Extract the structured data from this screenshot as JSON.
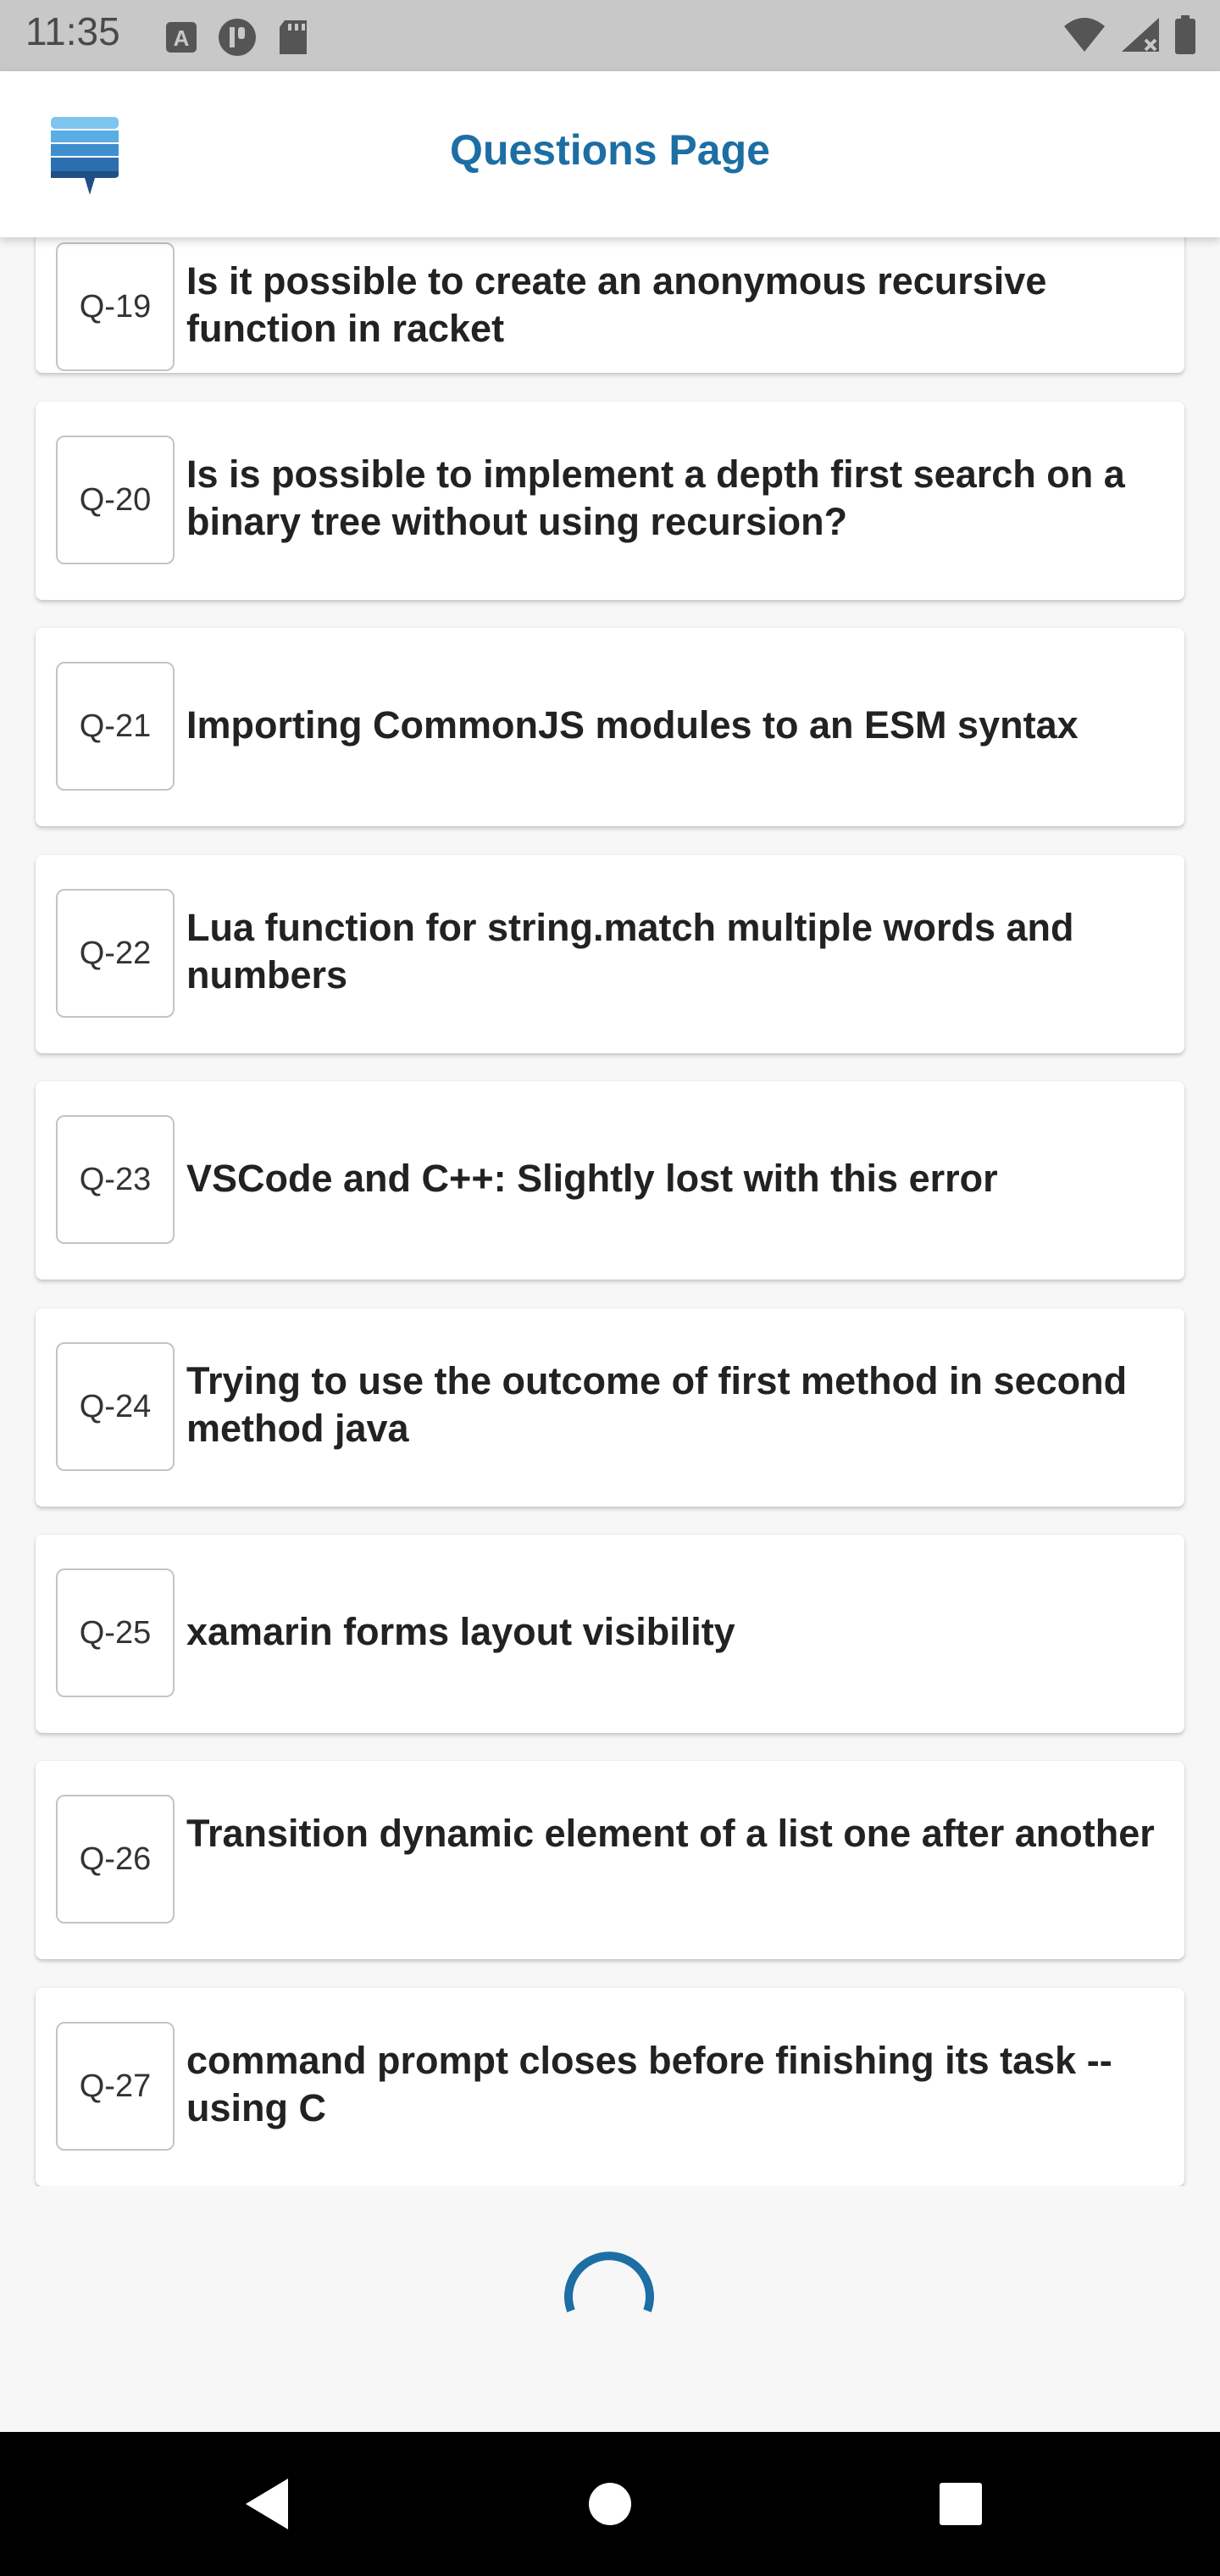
{
  "status_bar": {
    "time": "11:35",
    "left_icons": [
      "a-icon",
      "p-icon",
      "sd-card-icon"
    ],
    "right_icons": [
      "wifi-icon",
      "signal-icon",
      "battery-icon"
    ]
  },
  "app_bar": {
    "title": "Questions Page",
    "logo": "stack-logo-icon"
  },
  "questions": [
    {
      "id": "Q-19",
      "text": "Is it possible to create an anonymous recursive function in racket"
    },
    {
      "id": "Q-20",
      "text": "Is is possible to implement a depth first search on a binary tree without using recursion?"
    },
    {
      "id": "Q-21",
      "text": "Importing CommonJS modules to an ESM syntax"
    },
    {
      "id": "Q-22",
      "text": "Lua function for string.match multiple words and numbers"
    },
    {
      "id": "Q-23",
      "text": "VSCode and C++: Slightly lost with this error"
    },
    {
      "id": "Q-24",
      "text": "Trying to use the outcome of first method in second method java"
    },
    {
      "id": "Q-25",
      "text": "xamarin forms layout visibility"
    },
    {
      "id": "Q-26",
      "text": "Transition dynamic element of a list one after another"
    },
    {
      "id": "Q-27",
      "text": "command prompt closes before finishing its task -- using C"
    }
  ],
  "loading": true,
  "colors": {
    "accent": "#1c6ea4",
    "background": "#f7f7f7",
    "status_bar": "#c8c8c8",
    "nav_bar": "#000000"
  },
  "nav_bar": {
    "buttons": [
      "back-icon",
      "home-icon",
      "recents-icon"
    ]
  }
}
